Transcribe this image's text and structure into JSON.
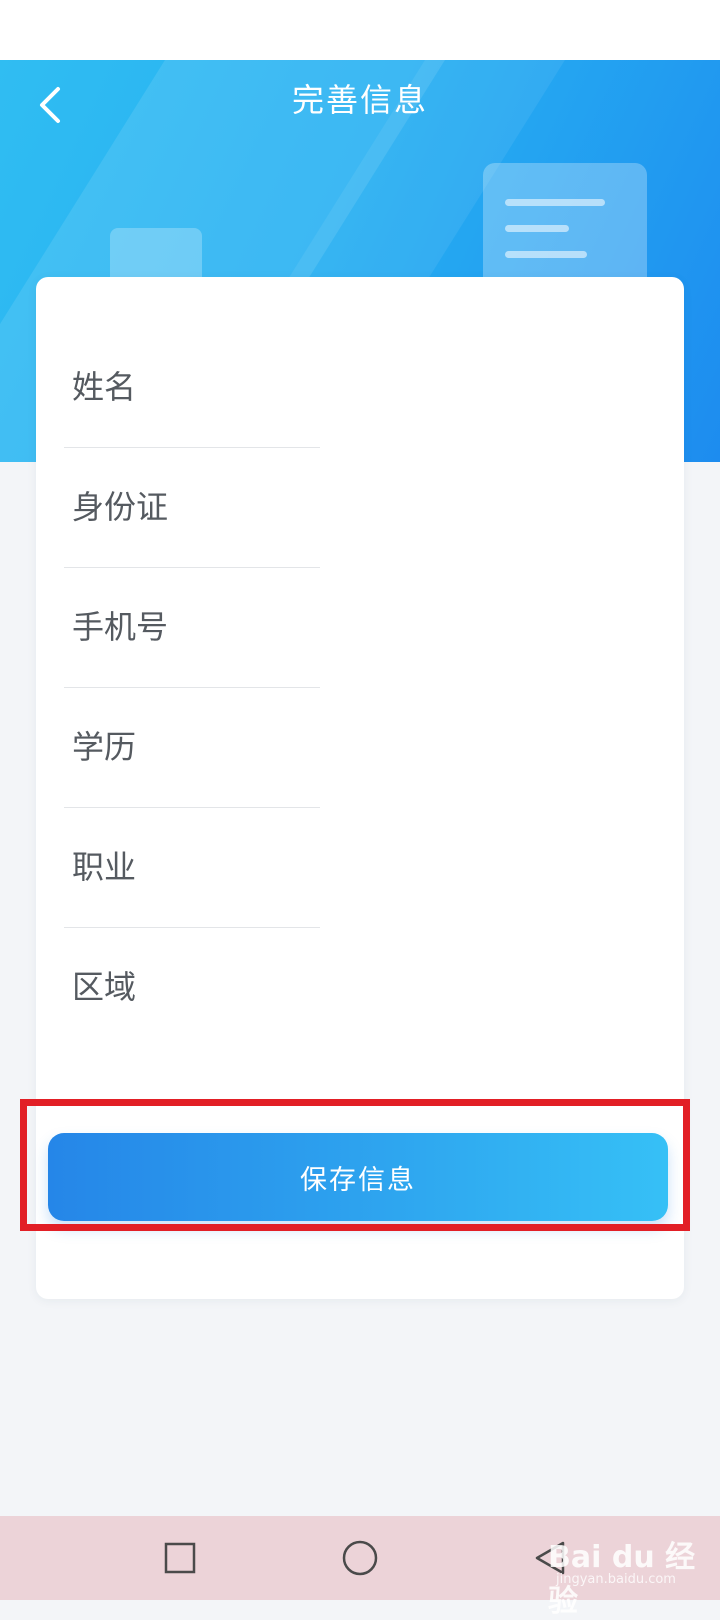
{
  "header": {
    "title": "完善信息"
  },
  "form": {
    "fields": [
      {
        "label": "姓名"
      },
      {
        "label": "身份证"
      },
      {
        "label": "手机号"
      },
      {
        "label": "学历"
      },
      {
        "label": "职业"
      },
      {
        "label": "区域"
      }
    ]
  },
  "save_label": "保存信息",
  "watermark": {
    "brand": "Bai du 经验",
    "url": "jingyan.baidu.com"
  },
  "colors": {
    "header_gradient": [
      "#30bdf2",
      "#1d8cef"
    ],
    "button_gradient": [
      "#2586e8",
      "#36c0f6"
    ],
    "highlight": "#e21f26",
    "nav_bar": "#ecd3d8"
  },
  "icons": {
    "back": "chevron-left-icon",
    "nav_recent": "square-icon",
    "nav_home": "circle-icon",
    "nav_back": "triangle-left-icon"
  }
}
